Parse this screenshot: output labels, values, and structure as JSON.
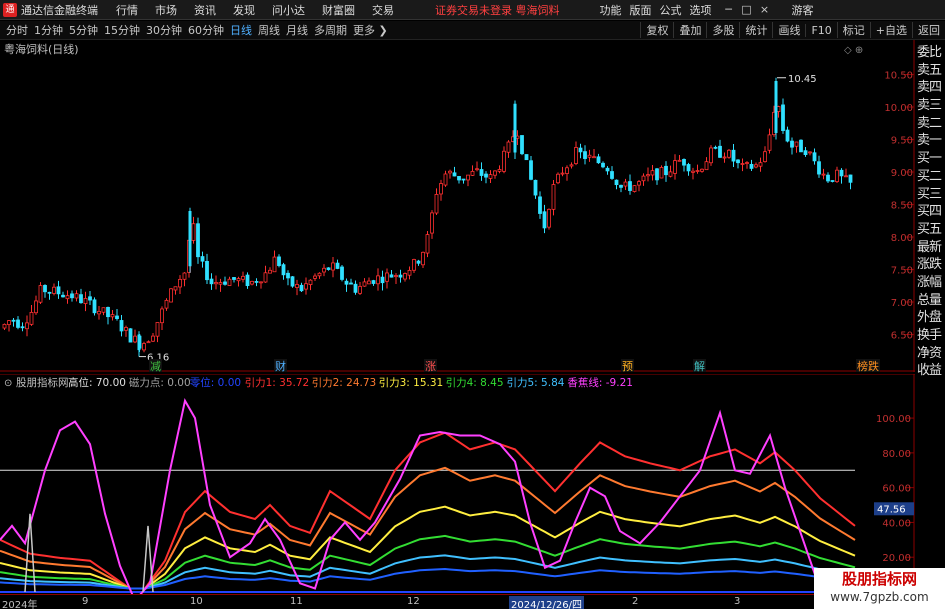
{
  "menubar": {
    "app_title": "通达信金融终端",
    "menus": [
      "行情",
      "市场",
      "资讯",
      "发现",
      "问小达",
      "财富圈",
      "交易"
    ],
    "notice": "证券交易未登录",
    "stock_name": "粤海饲料",
    "right_menus": [
      "功能",
      "版面",
      "公式",
      "选项"
    ],
    "guest": "游客"
  },
  "periods": {
    "items": [
      "分时",
      "1分钟",
      "5分钟",
      "15分钟",
      "30分钟",
      "60分钟",
      "日线",
      "周线",
      "月线",
      "多周期",
      "更多"
    ],
    "active": "日线",
    "tools": [
      "复权",
      "叠加",
      "多股",
      "统计",
      "画线",
      "F10",
      "标记",
      "+自选",
      "返回"
    ]
  },
  "kchart": {
    "label": "粤海饲料(日线)",
    "y_ticks": [
      "10.50",
      "10.00",
      "9.50",
      "9.00",
      "8.50",
      "8.00",
      "7.50",
      "7.00",
      "6.50"
    ],
    "high_label": "10.45",
    "low_label": "6.16",
    "event_markers": [
      "减",
      "财",
      "涨",
      "预",
      "解",
      "榜跌"
    ]
  },
  "indicator": {
    "name": "股朋指标网",
    "values": [
      {
        "label": "高位: 70.00",
        "color": "#e0e0e0"
      },
      {
        "label": "磁力点: 0.00",
        "color": "#a0a0a0"
      },
      {
        "label": "零位: 0.00",
        "color": "#2244ff"
      },
      {
        "label": "引力1: 35.72",
        "color": "#ff3030"
      },
      {
        "label": "引力2: 24.73",
        "color": "#ff7a30"
      },
      {
        "label": "引力3: 15.31",
        "color": "#ffee40"
      },
      {
        "label": "引力4: 8.45",
        "color": "#33dd33"
      },
      {
        "label": "引力5: 5.84",
        "color": "#40c0ff"
      },
      {
        "label": "香蕉线: -9.21",
        "color": "#ff40ff"
      }
    ],
    "y_ticks": [
      "100.00",
      "80.00",
      "60.00",
      "40.00",
      "20.00"
    ],
    "current_tag": "47.56"
  },
  "sidebar": [
    "委比",
    "卖五",
    "卖四",
    "卖三",
    "卖二",
    "卖一",
    "买一",
    "买二",
    "买三",
    "买四",
    "买五",
    "最新",
    "涨跌",
    "涨幅",
    "总量",
    "外盘",
    "换手",
    "净资",
    "收益"
  ],
  "time_axis": [
    "2024年",
    "9",
    "10",
    "11",
    "12",
    "2024/12/26/四",
    "2",
    "3"
  ],
  "watermark": {
    "title": "股朋指标网",
    "url": "www.7gpzb.com"
  },
  "chart_data": {
    "type": "candlestick",
    "ylim": [
      6.0,
      10.8
    ],
    "highest": 10.45,
    "lowest": 6.16,
    "indicator_ylim": [
      0,
      115
    ],
    "indicator_level": 70
  },
  "colors": {
    "up": "#ff3030",
    "down": "#30e0ff",
    "frame": "#8b0000"
  }
}
